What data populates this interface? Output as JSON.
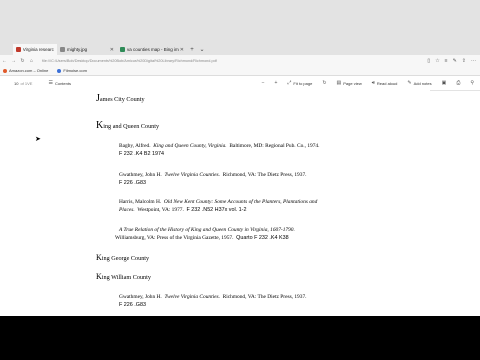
{
  "browser": {
    "tabs": [
      {
        "label": "Virginia research outlin",
        "active": true,
        "favicon_color": "#c0392b"
      },
      {
        "label": "mighty.jpg",
        "active": false,
        "favicon_color": "#888888"
      },
      {
        "label": "va counties map - Bing ima",
        "active": false,
        "favicon_color": "#2e8b57"
      }
    ],
    "url": "file:///C:/Users/Bob/Desktop/Documents%20Bob/Amicus%20Digital%20Library/Richmond/Richmond.pdf",
    "favorites": [
      {
        "label": "Amazon.com – Online"
      },
      {
        "label": "Filmoise.com"
      }
    ]
  },
  "pdf_toolbar": {
    "page": "10",
    "page_total": "of 1VE",
    "contents": "Contents",
    "fit_to_page": "Fit to page",
    "page_view": "Page view",
    "read_aloud": "Read aloud",
    "add_notes": "Add notes"
  },
  "document": {
    "james_city_initial": "J",
    "james_city_rest": "ames City County",
    "king_queen_initial": "K",
    "king_queen_rest": "ing and Queen County",
    "entry1": {
      "author": "Bagby, Alfred.",
      "title": "King and Queen County, Virginia.",
      "pub": "Baltimore, MD: Regional Pub. Co., 1974.",
      "call": "F 232 .K4 B2 1974"
    },
    "entry2": {
      "author": "Gwathmey, John H.",
      "title": "Twelve Virginia Counties.",
      "pub": "Richmond, VA: The Dietz Press, 1937.",
      "call": "F 226 .G83"
    },
    "entry3": {
      "author": "Harris, Malcolm H.",
      "title": "Old New Kent County: Some Accounts of the Planters, Plantations and",
      "title2": "Places.",
      "pub": "Westpoint, VA: 1977.",
      "call": "F 232 .N52 H37x vol. 1-2"
    },
    "entry4": {
      "title": "A True Relation of the History of King and Queen County in Virginia, 1607-1790.",
      "pub": "Williamsburg, VA: Press of the Virginia Gazette, 1957.",
      "call": "Quarto F 232 .K4 K38"
    },
    "king_george_initial": "K",
    "king_george_rest": "ing George County",
    "king_william_initial": "K",
    "king_william_rest": "ing William County",
    "entry5": {
      "author": "Gwathmey, John H.",
      "title": "Twelve Virginia Counties.",
      "pub": "Richmond, VA: The Dietz Press, 1937.",
      "call": "F 226 .G83"
    }
  }
}
